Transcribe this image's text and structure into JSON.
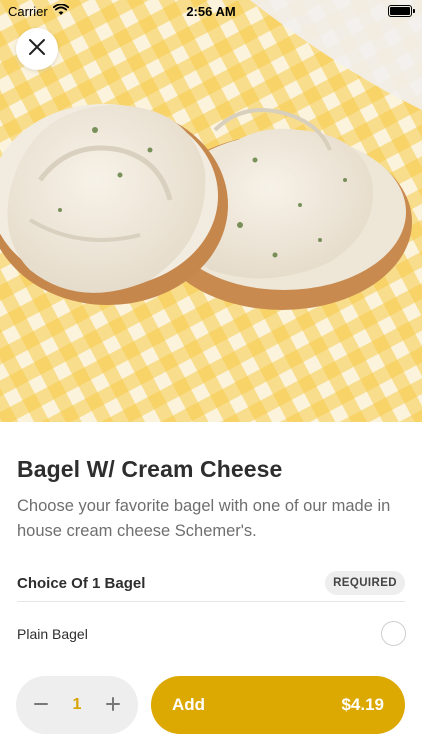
{
  "status_bar": {
    "carrier": "Carrier",
    "time": "2:56 AM",
    "icons": [
      "wifi-icon",
      "battery-icon"
    ]
  },
  "hero": {
    "image_subject": "bagel-with-cream-cheese-photo",
    "close_icon": "close-icon"
  },
  "item": {
    "title": "Bagel W/ Cream Cheese",
    "description": "Choose your favorite bagel with one of our made in house cream cheese Schemer's."
  },
  "choice_group": {
    "title": "Choice Of 1 Bagel",
    "badge": "REQUIRED",
    "options": [
      {
        "label": "Plain Bagel",
        "selected": false
      }
    ]
  },
  "order_bar": {
    "quantity": "1",
    "minus_icon": "minus-icon",
    "plus_icon": "plus-icon",
    "add_label": "Add",
    "price": "$4.19"
  },
  "colors": {
    "accent": "#dca802",
    "quantity_text": "#d6a300",
    "badge_bg": "#eeeeee"
  }
}
